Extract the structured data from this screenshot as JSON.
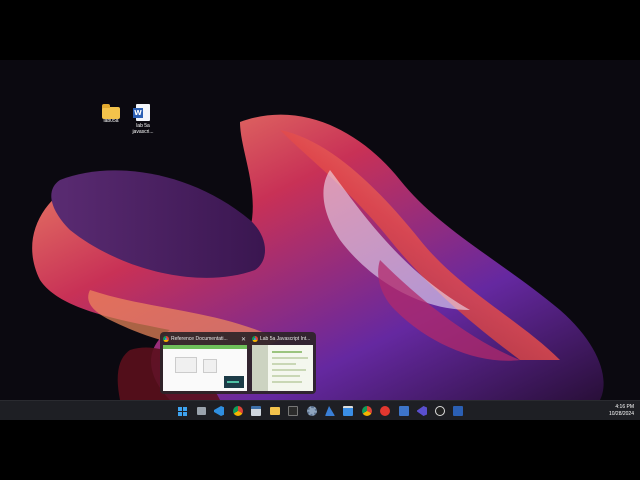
{
  "desktop": {
    "icons": [
      {
        "label": "lab05a",
        "icon": "folder-icon"
      },
      {
        "label": "lab 5a javascri...",
        "icon": "word-document-icon"
      }
    ]
  },
  "thumbnails": [
    {
      "title": "Reference Documentati...",
      "close": "✕",
      "icon": "chrome-icon"
    },
    {
      "title": "Lab 5a Javascript Int...",
      "icon": "chrome-icon"
    }
  ],
  "taskbar": {
    "items": [
      {
        "name": "start-button",
        "icon": "windows-start-icon"
      },
      {
        "name": "task-view-button",
        "icon": "task-view-icon"
      },
      {
        "name": "vscode-button",
        "icon": "vscode-icon"
      },
      {
        "name": "chrome-button",
        "icon": "chrome-icon"
      },
      {
        "name": "app-button",
        "icon": "app-window-icon"
      },
      {
        "name": "file-explorer-button",
        "icon": "folder-icon"
      },
      {
        "name": "terminal-button",
        "icon": "terminal-icon"
      },
      {
        "name": "settings-button",
        "icon": "gear-icon"
      },
      {
        "name": "azure-button",
        "icon": "azure-icon"
      },
      {
        "name": "app-store-button",
        "icon": "store-icon"
      },
      {
        "name": "chrome-profile-button",
        "icon": "chrome-icon"
      },
      {
        "name": "record-button",
        "icon": "record-icon"
      },
      {
        "name": "notepad-button",
        "icon": "notepad-icon"
      },
      {
        "name": "visual-studio-button",
        "icon": "visual-studio-icon"
      },
      {
        "name": "pen-tool-button",
        "icon": "pen-icon"
      },
      {
        "name": "clock-app-button",
        "icon": "clock-icon"
      },
      {
        "name": "word-button",
        "icon": "word-icon"
      }
    ],
    "clock": {
      "time": "4:16 PM",
      "date": "10/28/2024"
    }
  },
  "colors": {
    "taskbar_bg": "#1e1f24",
    "accent": "#5fb2f2",
    "folder": "#f3c24b",
    "word_blue": "#2b5fb4"
  }
}
